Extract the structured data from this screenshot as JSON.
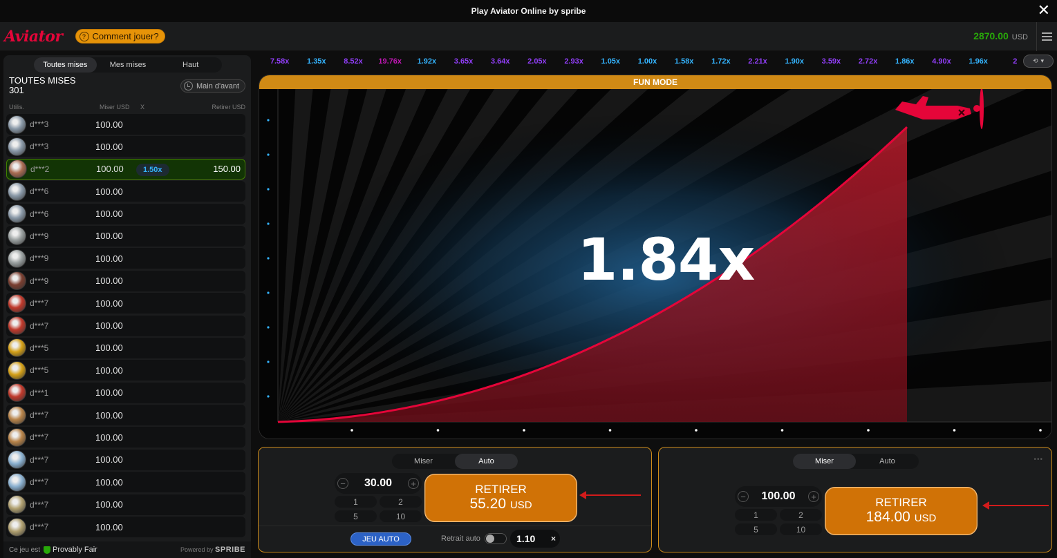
{
  "window": {
    "title": "Play Aviator Online by spribe"
  },
  "header": {
    "logo": "Aviator",
    "how_to_play": "Comment jouer?",
    "balance": "2870.00",
    "currency": "USD"
  },
  "left_panel": {
    "tabs": [
      "Toutes mises",
      "Mes mises",
      "Haut"
    ],
    "title": "TOUTES MISES",
    "count": "301",
    "prev_hand": "Main d'avant",
    "columns": {
      "user": "Utilis.",
      "bet": "Miser USD",
      "x": "X",
      "cashout": "Retirer USD"
    },
    "rows": [
      {
        "user": "d***3",
        "bet": "100.00",
        "avatar": "#8a99a8"
      },
      {
        "user": "d***3",
        "bet": "100.00",
        "avatar": "#8a99a8"
      },
      {
        "user": "d***2",
        "bet": "100.00",
        "mult": "1.50x",
        "cashout": "150.00",
        "win": true,
        "avatar": "#a96c52"
      },
      {
        "user": "d***6",
        "bet": "100.00",
        "avatar": "#8a99a8"
      },
      {
        "user": "d***6",
        "bet": "100.00",
        "avatar": "#8a99a8"
      },
      {
        "user": "d***9",
        "bet": "100.00",
        "avatar": "#9aa0a0"
      },
      {
        "user": "d***9",
        "bet": "100.00",
        "avatar": "#9aa0a0"
      },
      {
        "user": "d***9",
        "bet": "100.00",
        "avatar": "#7a3e30"
      },
      {
        "user": "d***7",
        "bet": "100.00",
        "avatar": "#c0392b"
      },
      {
        "user": "d***7",
        "bet": "100.00",
        "avatar": "#c0392b"
      },
      {
        "user": "d***5",
        "bet": "100.00",
        "avatar": "#d4a017"
      },
      {
        "user": "d***5",
        "bet": "100.00",
        "avatar": "#d4a017"
      },
      {
        "user": "d***1",
        "bet": "100.00",
        "avatar": "#c0392b"
      },
      {
        "user": "d***7",
        "bet": "100.00",
        "avatar": "#b8844a"
      },
      {
        "user": "d***7",
        "bet": "100.00",
        "avatar": "#b8844a"
      },
      {
        "user": "d***7",
        "bet": "100.00",
        "avatar": "#8ab0d0"
      },
      {
        "user": "d***7",
        "bet": "100.00",
        "avatar": "#8ab0d0"
      },
      {
        "user": "d***7",
        "bet": "100.00",
        "avatar": "#b0a070"
      },
      {
        "user": "d***7",
        "bet": "100.00",
        "avatar": "#b0a070"
      }
    ],
    "footer": {
      "game_is": "Ce jeu est",
      "provably_fair": "Provably Fair",
      "powered_by": "Powered by",
      "brand": "SPRIBE"
    }
  },
  "history": [
    {
      "v": "7.58x",
      "c": "#913ef8"
    },
    {
      "v": "1.35x",
      "c": "#34b4ff"
    },
    {
      "v": "8.52x",
      "c": "#913ef8"
    },
    {
      "v": "19.76x",
      "c": "#c017b4"
    },
    {
      "v": "1.92x",
      "c": "#34b4ff"
    },
    {
      "v": "3.65x",
      "c": "#913ef8"
    },
    {
      "v": "3.64x",
      "c": "#913ef8"
    },
    {
      "v": "2.05x",
      "c": "#913ef8"
    },
    {
      "v": "2.93x",
      "c": "#913ef8"
    },
    {
      "v": "1.05x",
      "c": "#34b4ff"
    },
    {
      "v": "1.00x",
      "c": "#34b4ff"
    },
    {
      "v": "1.58x",
      "c": "#34b4ff"
    },
    {
      "v": "1.72x",
      "c": "#34b4ff"
    },
    {
      "v": "2.21x",
      "c": "#913ef8"
    },
    {
      "v": "1.90x",
      "c": "#34b4ff"
    },
    {
      "v": "3.59x",
      "c": "#913ef8"
    },
    {
      "v": "2.72x",
      "c": "#913ef8"
    },
    {
      "v": "1.86x",
      "c": "#34b4ff"
    },
    {
      "v": "4.90x",
      "c": "#913ef8"
    },
    {
      "v": "1.96x",
      "c": "#34b4ff"
    },
    {
      "v": "2",
      "c": "#913ef8"
    }
  ],
  "game": {
    "mode_label": "FUN MODE",
    "multiplier": "1.84x"
  },
  "bet_panel_1": {
    "tabs": [
      "Miser",
      "Auto"
    ],
    "active_tab": "Auto",
    "stake": "30.00",
    "quick": [
      "1",
      "2",
      "5",
      "10"
    ],
    "cashout_label": "RETIRER",
    "cashout_amount": "55.20",
    "currency": "USD",
    "auto_play": "JEU AUTO",
    "auto_cashout_label": "Retrait auto",
    "auto_cashout_value": "1.10",
    "clear": "×"
  },
  "bet_panel_2": {
    "tabs": [
      "Miser",
      "Auto"
    ],
    "active_tab": "Miser",
    "stake": "100.00",
    "quick": [
      "1",
      "2",
      "5",
      "10"
    ],
    "cashout_label": "RETIRER",
    "cashout_amount": "184.00",
    "currency": "USD"
  }
}
